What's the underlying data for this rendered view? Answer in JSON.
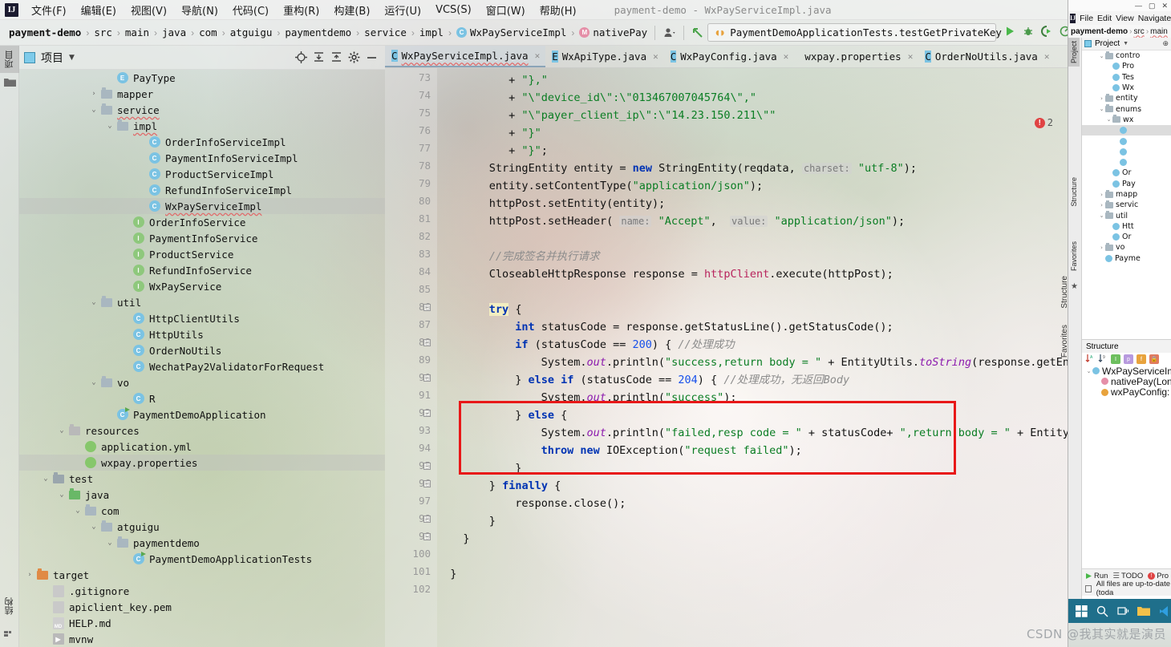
{
  "window": {
    "title": "payment-demo - WxPayServiceImpl.java",
    "logo": "IJ"
  },
  "menubar": {
    "items": [
      {
        "label": "文件(F)",
        "name": "menu-file"
      },
      {
        "label": "编辑(E)",
        "name": "menu-edit"
      },
      {
        "label": "视图(V)",
        "name": "menu-view"
      },
      {
        "label": "导航(N)",
        "name": "menu-navigate"
      },
      {
        "label": "代码(C)",
        "name": "menu-code"
      },
      {
        "label": "重构(R)",
        "name": "menu-refactor"
      },
      {
        "label": "构建(B)",
        "name": "menu-build"
      },
      {
        "label": "运行(U)",
        "name": "menu-run"
      },
      {
        "label": "VCS(S)",
        "name": "menu-vcs"
      },
      {
        "label": "窗口(W)",
        "name": "menu-window"
      },
      {
        "label": "帮助(H)",
        "name": "menu-help"
      }
    ]
  },
  "breadcrumb": {
    "items": [
      {
        "label": "payment-demo",
        "icon": "",
        "bold": true,
        "squiggle": false
      },
      {
        "label": "src",
        "icon": "",
        "bold": false,
        "squiggle": true
      },
      {
        "label": "main",
        "icon": "",
        "bold": false,
        "squiggle": true
      },
      {
        "label": "java",
        "icon": "",
        "bold": false,
        "squiggle": true
      },
      {
        "label": "com",
        "icon": "",
        "bold": false,
        "squiggle": true
      },
      {
        "label": "atguigu",
        "icon": "",
        "bold": false,
        "squiggle": true
      },
      {
        "label": "paymentdemo",
        "icon": "",
        "bold": false,
        "squiggle": true
      },
      {
        "label": "service",
        "icon": "",
        "bold": false,
        "squiggle": true
      },
      {
        "label": "impl",
        "icon": "",
        "bold": false,
        "squiggle": true
      },
      {
        "label": "WxPayServiceImpl",
        "icon": "c",
        "bold": false,
        "squiggle": true
      },
      {
        "label": "nativePay",
        "icon": "m",
        "bold": false,
        "squiggle": true
      }
    ]
  },
  "toolbar": {
    "run_config": "PaymentDemoApplicationTests.testGetPrivateKey",
    "icons": {
      "vcs_user": "user-icon",
      "back_arrow": "back-arrow-icon",
      "run": "run-icon",
      "debug": "debug-icon",
      "run_coverage": "run-with-coverage-icon",
      "profile": "profiler-icon"
    }
  },
  "project_panel": {
    "title": "项目",
    "toolbar_icons": [
      "locate-icon",
      "expand-all-icon",
      "collapse-all-icon",
      "settings-gear-icon",
      "minimize-icon"
    ],
    "tree": [
      {
        "indent": 5,
        "arrow": "",
        "icon": "enum",
        "label": "PayType",
        "squiggle": false,
        "sel": false
      },
      {
        "indent": 4,
        "arrow": "right",
        "icon": "folder",
        "label": "mapper",
        "squiggle": false,
        "sel": false
      },
      {
        "indent": 4,
        "arrow": "down",
        "icon": "folder",
        "label": "service",
        "squiggle": true,
        "sel": false
      },
      {
        "indent": 5,
        "arrow": "down",
        "icon": "folder",
        "label": "impl",
        "squiggle": true,
        "sel": false
      },
      {
        "indent": 7,
        "arrow": "",
        "icon": "class",
        "label": "OrderInfoServiceImpl",
        "squiggle": false,
        "sel": false
      },
      {
        "indent": 7,
        "arrow": "",
        "icon": "class",
        "label": "PaymentInfoServiceImpl",
        "squiggle": false,
        "sel": false
      },
      {
        "indent": 7,
        "arrow": "",
        "icon": "class",
        "label": "ProductServiceImpl",
        "squiggle": false,
        "sel": false
      },
      {
        "indent": 7,
        "arrow": "",
        "icon": "class",
        "label": "RefundInfoServiceImpl",
        "squiggle": false,
        "sel": false
      },
      {
        "indent": 7,
        "arrow": "",
        "icon": "class",
        "label": "WxPayServiceImpl",
        "squiggle": true,
        "sel": true
      },
      {
        "indent": 6,
        "arrow": "",
        "icon": "iface",
        "label": "OrderInfoService",
        "squiggle": false,
        "sel": false
      },
      {
        "indent": 6,
        "arrow": "",
        "icon": "iface",
        "label": "PaymentInfoService",
        "squiggle": false,
        "sel": false
      },
      {
        "indent": 6,
        "arrow": "",
        "icon": "iface",
        "label": "ProductService",
        "squiggle": false,
        "sel": false
      },
      {
        "indent": 6,
        "arrow": "",
        "icon": "iface",
        "label": "RefundInfoService",
        "squiggle": false,
        "sel": false
      },
      {
        "indent": 6,
        "arrow": "",
        "icon": "iface",
        "label": "WxPayService",
        "squiggle": false,
        "sel": false
      },
      {
        "indent": 4,
        "arrow": "down",
        "icon": "folder",
        "label": "util",
        "squiggle": false,
        "sel": false
      },
      {
        "indent": 6,
        "arrow": "",
        "icon": "class",
        "label": "HttpClientUtils",
        "squiggle": false,
        "sel": false
      },
      {
        "indent": 6,
        "arrow": "",
        "icon": "class",
        "label": "HttpUtils",
        "squiggle": false,
        "sel": false
      },
      {
        "indent": 6,
        "arrow": "",
        "icon": "class",
        "label": "OrderNoUtils",
        "squiggle": false,
        "sel": false
      },
      {
        "indent": 6,
        "arrow": "",
        "icon": "class",
        "label": "WechatPay2ValidatorForRequest",
        "squiggle": false,
        "sel": false
      },
      {
        "indent": 4,
        "arrow": "down",
        "icon": "folder",
        "label": "vo",
        "squiggle": false,
        "sel": false
      },
      {
        "indent": 6,
        "arrow": "",
        "icon": "class",
        "label": "R",
        "squiggle": false,
        "sel": false
      },
      {
        "indent": 5,
        "arrow": "",
        "icon": "runclass",
        "label": "PaymentDemoApplication",
        "squiggle": false,
        "sel": false
      },
      {
        "indent": 2,
        "arrow": "down",
        "icon": "resources",
        "label": "resources",
        "squiggle": false,
        "sel": false
      },
      {
        "indent": 3,
        "arrow": "",
        "icon": "yml",
        "label": "application.yml",
        "squiggle": false,
        "sel": false
      },
      {
        "indent": 3,
        "arrow": "",
        "icon": "yml",
        "label": "wxpay.properties",
        "squiggle": false,
        "sel": true
      },
      {
        "indent": 1,
        "arrow": "down",
        "icon": "folder-plain",
        "label": "test",
        "squiggle": false,
        "sel": false
      },
      {
        "indent": 2,
        "arrow": "down",
        "icon": "folder-green",
        "label": "java",
        "squiggle": false,
        "sel": false
      },
      {
        "indent": 3,
        "arrow": "down",
        "icon": "folder",
        "label": "com",
        "squiggle": false,
        "sel": false
      },
      {
        "indent": 4,
        "arrow": "down",
        "icon": "folder",
        "label": "atguigu",
        "squiggle": false,
        "sel": false
      },
      {
        "indent": 5,
        "arrow": "down",
        "icon": "folder",
        "label": "paymentdemo",
        "squiggle": false,
        "sel": false
      },
      {
        "indent": 6,
        "arrow": "",
        "icon": "runclass",
        "label": "PaymentDemoApplicationTests",
        "squiggle": false,
        "sel": false
      },
      {
        "indent": 0,
        "arrow": "right",
        "icon": "folder-orange",
        "label": "target",
        "squiggle": false,
        "sel": false
      },
      {
        "indent": 1,
        "arrow": "",
        "icon": "file-git",
        "label": ".gitignore",
        "squiggle": false,
        "sel": false
      },
      {
        "indent": 1,
        "arrow": "",
        "icon": "file",
        "label": "apiclient_key.pem",
        "squiggle": false,
        "sel": false
      },
      {
        "indent": 1,
        "arrow": "",
        "icon": "file-md",
        "label": "HELP.md",
        "squiggle": false,
        "sel": false
      },
      {
        "indent": 1,
        "arrow": "",
        "icon": "file-sh",
        "label": "mvnw",
        "squiggle": false,
        "sel": false
      }
    ]
  },
  "left_strip": {
    "tabs": [
      {
        "label": "项目",
        "active": true,
        "name": "tool-tab-project"
      },
      {
        "label": "结构",
        "active": false,
        "name": "tool-tab-structure"
      }
    ]
  },
  "editor": {
    "tabs": [
      {
        "label": "WxPayServiceImpl.java",
        "icon": "c",
        "active": true,
        "squiggle": true
      },
      {
        "label": "WxApiType.java",
        "icon": "e",
        "active": false,
        "squiggle": false
      },
      {
        "label": "WxPayConfig.java",
        "icon": "c",
        "active": false,
        "squiggle": false
      },
      {
        "label": "wxpay.properties",
        "icon": "yml",
        "active": false,
        "squiggle": false
      },
      {
        "label": "OrderNoUtils.java",
        "icon": "c",
        "active": false,
        "squiggle": false
      }
    ],
    "error_count": "2",
    "first_line": 73,
    "last_line": 102,
    "lines": [
      {
        "n": 73,
        "indent": 11,
        "html": "+ <s>\"},\"</s>"
      },
      {
        "n": 74,
        "indent": 11,
        "html": "+ <s>\"\\\"device_id\\\":\\\"013467007045764\\\",\"</s>"
      },
      {
        "n": 75,
        "indent": 11,
        "html": "+ <s>\"\\\"payer_client_ip\\\":\\\"14.23.150.211\\\"\"</s>"
      },
      {
        "n": 76,
        "indent": 11,
        "html": "+ <s>\"}\"</s>"
      },
      {
        "n": 77,
        "indent": 11,
        "html": "+ <s>\"}\"</s>;"
      },
      {
        "n": 78,
        "indent": 8,
        "html": "StringEntity entity = <k>new</k> StringEntity(reqdata, <h>charset:</h> <s>\"utf-8\"</s>);"
      },
      {
        "n": 79,
        "indent": 8,
        "html": "entity.setContentType(<s>\"application/json\"</s>);"
      },
      {
        "n": 80,
        "indent": 8,
        "html": "httpPost.setEntity(entity);"
      },
      {
        "n": 81,
        "indent": 8,
        "html": "httpPost.setHeader( <h>name:</h> <s>\"Accept\"</s>,  <h>value:</h> <s>\"application/json\"</s>);"
      },
      {
        "n": 82,
        "indent": 8,
        "html": ""
      },
      {
        "n": 83,
        "indent": 8,
        "html": "<c>//完成签名并执行请求</c>"
      },
      {
        "n": 84,
        "indent": 8,
        "html": "CloseableHttpResponse response = <f2>httpClient</f2>.execute(httpPost);"
      },
      {
        "n": 85,
        "indent": 8,
        "html": ""
      },
      {
        "n": 86,
        "indent": 8,
        "html": "<t>try</t> {"
      },
      {
        "n": 87,
        "indent": 12,
        "html": "<k>int</k> statusCode = response.getStatusLine().getStatusCode();"
      },
      {
        "n": 88,
        "indent": 12,
        "html": "<k>if</k> (statusCode == <n>200</n>) { <c>//处理成功</c>"
      },
      {
        "n": 89,
        "indent": 16,
        "html": "System.<i>out</i>.println(<s>\"success,return body = \"</s> + EntityUtils.<i>toString</i>(response.getEn"
      },
      {
        "n": 90,
        "indent": 12,
        "html": "} <k>else if</k> (statusCode == <n>204</n>) { <c>//处理成功，无返回Body</c>"
      },
      {
        "n": 91,
        "indent": 16,
        "html": "System.<i>out</i>.println(<s>\"success\"</s>);"
      },
      {
        "n": 92,
        "indent": 12,
        "html": "} <k>else</k> {"
      },
      {
        "n": 93,
        "indent": 16,
        "html": "System.<i>out</i>.println(<s>\"failed,resp code = \"</s> + statusCode+ <s>\",return body = \"</s> + EntityUtils.<i>toString</i>"
      },
      {
        "n": 94,
        "indent": 16,
        "html": "<k>throw new</k> IOException(<s>\"request failed\"</s>);"
      },
      {
        "n": 95,
        "indent": 12,
        "html": "}"
      },
      {
        "n": 96,
        "indent": 8,
        "html": "} <k>finally</k> {"
      },
      {
        "n": 97,
        "indent": 12,
        "html": "response.close();"
      },
      {
        "n": 98,
        "indent": 8,
        "html": "}"
      },
      {
        "n": 99,
        "indent": 4,
        "html": "}"
      },
      {
        "n": 100,
        "indent": 4,
        "html": ""
      },
      {
        "n": 101,
        "indent": 2,
        "html": "}"
      },
      {
        "n": 102,
        "indent": 2,
        "html": ""
      }
    ],
    "annotation": {
      "shape": "rectangle",
      "color": "#e81818",
      "covers_lines": "92-95"
    }
  },
  "right_strip": {
    "tabs": [
      {
        "label": "Structure",
        "name": "main-tab-structure"
      },
      {
        "label": "Favorites",
        "name": "main-tab-favorites"
      }
    ]
  },
  "window2": {
    "menubar": [
      "File",
      "Edit",
      "View",
      "Navigate"
    ],
    "breadcrumb": [
      "payment-demo",
      "src",
      "main"
    ],
    "panel_title": "Project",
    "tree": [
      {
        "indent": 2,
        "arrow": "down",
        "icon": "folder",
        "label": "contro"
      },
      {
        "indent": 3,
        "arrow": "",
        "icon": "class",
        "label": "Pro"
      },
      {
        "indent": 3,
        "arrow": "",
        "icon": "class",
        "label": "Tes"
      },
      {
        "indent": 3,
        "arrow": "",
        "icon": "class",
        "label": "Wx"
      },
      {
        "indent": 2,
        "arrow": "right",
        "icon": "folder",
        "label": "entity"
      },
      {
        "indent": 2,
        "arrow": "down",
        "icon": "folder",
        "label": "enums"
      },
      {
        "indent": 3,
        "arrow": "down",
        "icon": "folder",
        "label": "wx"
      },
      {
        "indent": 4,
        "arrow": "",
        "icon": "enum",
        "label": ""
      },
      {
        "indent": 4,
        "arrow": "",
        "icon": "enum",
        "label": ""
      },
      {
        "indent": 4,
        "arrow": "",
        "icon": "enum",
        "label": ""
      },
      {
        "indent": 4,
        "arrow": "",
        "icon": "enum",
        "label": ""
      },
      {
        "indent": 3,
        "arrow": "",
        "icon": "enum",
        "label": "Or"
      },
      {
        "indent": 3,
        "arrow": "",
        "icon": "enum",
        "label": "Pay"
      },
      {
        "indent": 2,
        "arrow": "right",
        "icon": "folder",
        "label": "mapp"
      },
      {
        "indent": 2,
        "arrow": "right",
        "icon": "folder",
        "label": "servic"
      },
      {
        "indent": 2,
        "arrow": "down",
        "icon": "folder",
        "label": "util"
      },
      {
        "indent": 3,
        "arrow": "",
        "icon": "class",
        "label": "Htt"
      },
      {
        "indent": 3,
        "arrow": "",
        "icon": "class",
        "label": "Or"
      },
      {
        "indent": 2,
        "arrow": "right",
        "icon": "folder",
        "label": "vo"
      },
      {
        "indent": 2,
        "arrow": "",
        "icon": "runclass",
        "label": "Payme"
      }
    ],
    "structure": {
      "title": "Structure",
      "items": [
        {
          "indent": 0,
          "icon": "class",
          "label": "WxPayServiceImpl"
        },
        {
          "indent": 1,
          "icon": "method",
          "label": "nativePay(Long)"
        },
        {
          "indent": 1,
          "icon": "field",
          "label": "wxPayConfig: W"
        }
      ]
    },
    "statusbar": {
      "run": "Run",
      "todo": "TODO",
      "problems": "Pro",
      "message": "All files are up-to-date (toda"
    },
    "vtabs": [
      {
        "label": "Project"
      },
      {
        "label": "Structure"
      },
      {
        "label": "Favorites"
      }
    ]
  },
  "watermark": "CSDN @我其实就是演员"
}
